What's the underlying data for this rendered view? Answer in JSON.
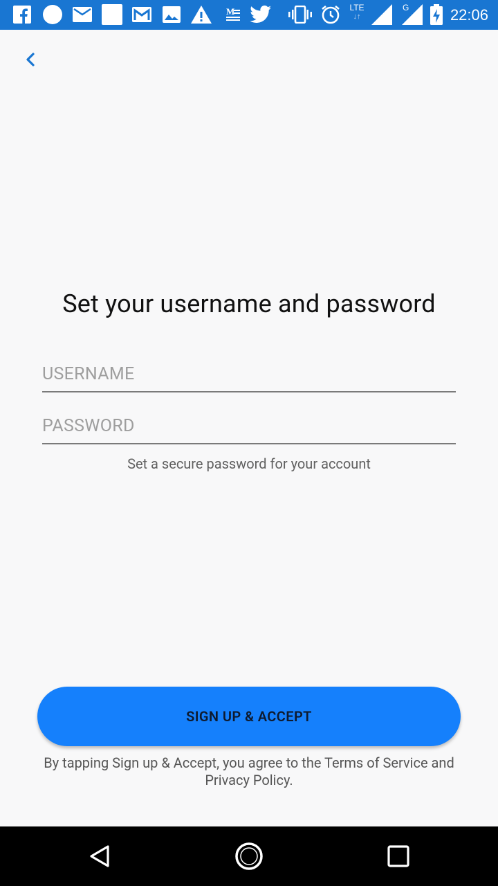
{
  "status_bar": {
    "time": "22:06",
    "network_label": "LTE",
    "network_arrows": "↓↑",
    "secondary_network": "G",
    "icons": [
      "facebook-icon",
      "circle-icon",
      "email-icon",
      "blank-notification-icon",
      "gmail-icon",
      "photo-icon",
      "warning-icon",
      "medium-icon",
      "twitter-icon",
      "vibrate-icon",
      "alarm-icon",
      "lte-signal-icon",
      "g-signal-icon",
      "battery-charging-icon"
    ]
  },
  "header": {
    "back_icon": "chevron-left-icon"
  },
  "form": {
    "title": "Set your username and password",
    "username_placeholder": "USERNAME",
    "password_placeholder": "PASSWORD",
    "hint": "Set a secure password for your account",
    "submit_label": "SIGN UP & ACCEPT",
    "terms": "By tapping Sign up & Accept, you agree to the Terms of Service and Privacy Policy."
  },
  "colors": {
    "status_bar": "#1976d2",
    "accent": "#1580fc",
    "background": "#f8f8f9"
  },
  "nav_bar": {
    "icons": [
      "back-triangle-icon",
      "home-circle-icon",
      "recents-square-icon"
    ]
  }
}
